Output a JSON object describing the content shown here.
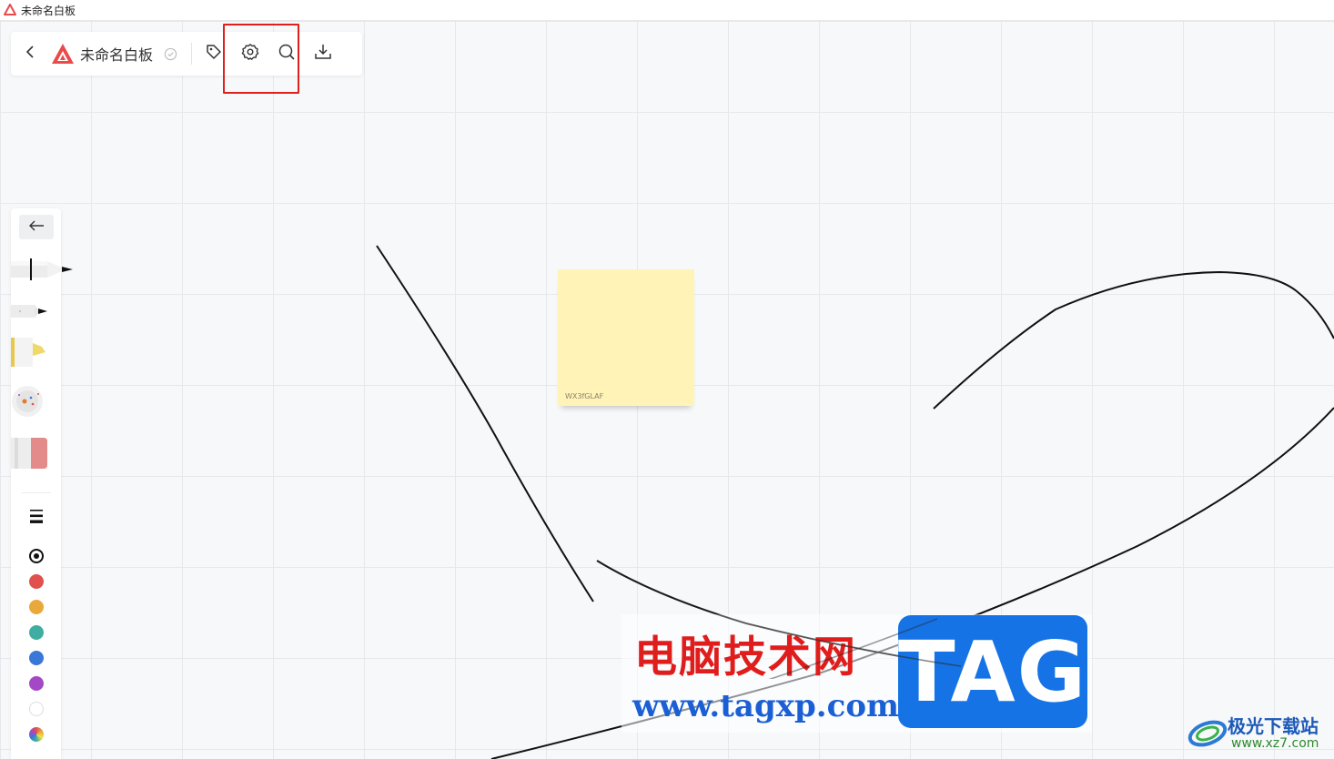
{
  "window": {
    "title": "未命名白板"
  },
  "toolbar": {
    "board_title": "未命名白板",
    "buttons": [
      "back-icon",
      "tag-icon",
      "settings-icon",
      "search-icon",
      "download-icon"
    ]
  },
  "tools": [
    "pen",
    "marker",
    "highlighter",
    "laser-pointer",
    "eraser"
  ],
  "colors": {
    "black": "#111111",
    "red": "#e0504c",
    "orange": "#e9a93a",
    "teal": "#3fada1",
    "blue": "#3a78d8",
    "purple": "#a349c6",
    "white": "#ffffff",
    "highlight_border": "#e0201c",
    "sticky_bg": "#fff3b8",
    "brand": "#e94a4a"
  },
  "sticky_note": {
    "author": "WX3fGLAF"
  },
  "watermark": {
    "cn_text": "电脑技术网",
    "url": "www.tagxp.com",
    "tag": "TAG",
    "site_name": "极光下载站",
    "site_url": "www.xz7.com"
  }
}
